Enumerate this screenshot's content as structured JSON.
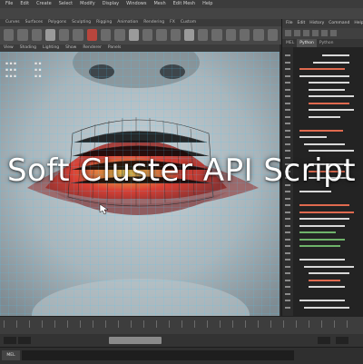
{
  "overlay_title": "Soft Cluster API Script",
  "colors": {
    "accent_red": "#b9463d",
    "mesh_wire": "#3ecbff",
    "falloff_hot": "#e23b2e",
    "falloff_warm": "#f2d34a",
    "panel_dark": "#232323"
  },
  "menubar": {
    "items": [
      "File",
      "Edit",
      "Create",
      "Select",
      "Modify",
      "Display",
      "Windows",
      "Mesh",
      "Edit Mesh",
      "Help"
    ]
  },
  "shelf": {
    "tabs": [
      "Curves",
      "Surfaces",
      "Polygons",
      "Sculpting",
      "Rigging",
      "Animation",
      "Rendering",
      "FX",
      "Custom"
    ]
  },
  "view_menu": {
    "items": [
      "View",
      "Shading",
      "Lighting",
      "Show",
      "Renderer",
      "Panels"
    ]
  },
  "right_panel": {
    "menu": [
      "File",
      "Edit",
      "History",
      "Command",
      "Help"
    ],
    "tabs": [
      "MEL",
      "Python",
      "Python"
    ]
  },
  "command_line": {
    "label": "MEL"
  }
}
